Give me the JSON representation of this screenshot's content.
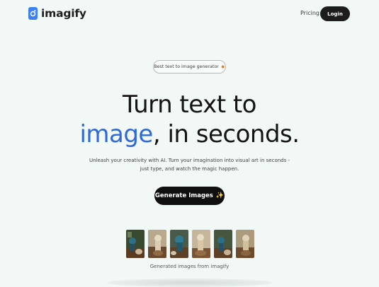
{
  "header": {
    "brand": "imagify",
    "nav_pricing": "Pricing",
    "login_label": "Login"
  },
  "hero": {
    "badge_text": "Best text to image generator",
    "title_line1": "Turn text to",
    "title_accent": "image",
    "title_line2_rest": ", in seconds.",
    "subtitle_line1": "Unleash your creativity with AI. Turn your imagination into visual art in seconds -",
    "subtitle_line2": "just type, and watch the magic happen.",
    "cta_label": "Generate Images",
    "cta_icon": "sparkles-icon"
  },
  "gallery": {
    "caption": "Generated images from imagify",
    "thumbnails": [
      "generated-image",
      "generated-image",
      "generated-image",
      "generated-image",
      "generated-image",
      "generated-image"
    ]
  },
  "colors": {
    "background": "#f1f8f5",
    "accent": "#2f69d8",
    "button_dark": "#0f0f0f"
  }
}
